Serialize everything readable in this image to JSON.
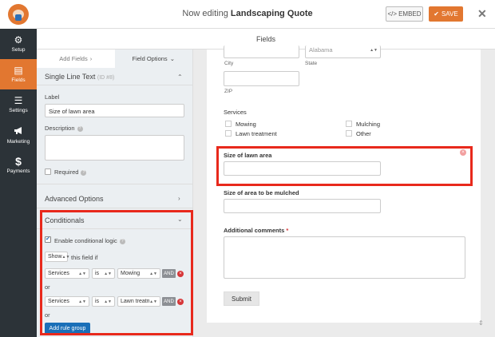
{
  "header": {
    "title_prefix": "Now editing ",
    "title_form": "Landscaping Quote",
    "embed_label": "EMBED",
    "save_label": "SAVE",
    "close_glyph": "✕"
  },
  "sidebar": {
    "items": [
      {
        "label": "Setup",
        "icon": "gear-icon",
        "glyph": "⚙"
      },
      {
        "label": "Fields",
        "icon": "fields-icon",
        "glyph": "▤"
      },
      {
        "label": "Settings",
        "icon": "sliders-icon",
        "glyph": "☰"
      },
      {
        "label": "Marketing",
        "icon": "megaphone-icon",
        "glyph": "📢"
      },
      {
        "label": "Payments",
        "icon": "dollar-icon",
        "glyph": "$"
      }
    ],
    "active": "Fields"
  },
  "subheader": {
    "title": "Fields"
  },
  "panel": {
    "tabs": [
      {
        "label": "Add Fields"
      },
      {
        "label": "Field Options"
      }
    ],
    "field_type": "Single Line Text",
    "field_id": "(ID #8)",
    "label_title": "Label",
    "label_value": "Size of lawn area",
    "description_title": "Description",
    "required_label": "Required",
    "advanced_title": "Advanced Options",
    "conditionals_title": "Conditionals",
    "enable_logic_label": "Enable conditional logic",
    "show_value": "Show",
    "field_if_text": "this field if",
    "rules": [
      {
        "field": "Services",
        "operator": "is",
        "value": "Mowing",
        "and_label": "AND"
      },
      {
        "field": "Services",
        "operator": "is",
        "value": "Lawn treatmer",
        "and_label": "AND"
      }
    ],
    "or_label": "or",
    "add_rule_group_label": "Add rule group"
  },
  "preview": {
    "state_value": "Alabama",
    "city_label": "City",
    "state_label": "State",
    "zip_label": "ZIP",
    "services_label": "Services",
    "services_options": [
      "Mowing",
      "Mulching",
      "Lawn treatment",
      "Other"
    ],
    "lawn_area_label": "Size of lawn area",
    "mulched_label": "Size of area to be mulched",
    "comments_label": "Additional comments",
    "required_mark": "*",
    "submit_label": "Submit"
  },
  "colors": {
    "accent": "#e27730",
    "sidebar_bg": "#2c3338",
    "highlight_border": "#e8291c",
    "link_blue": "#1a6fb8"
  }
}
